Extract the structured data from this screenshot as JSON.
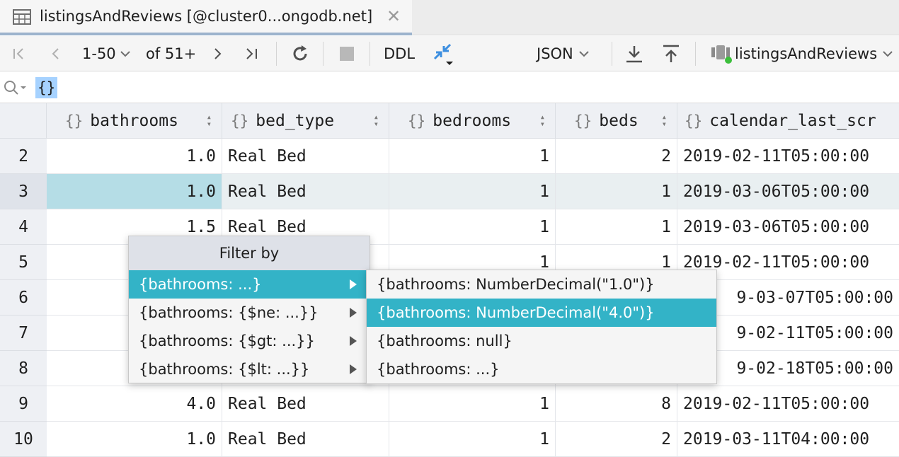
{
  "tab": {
    "title": "listingsAndReviews [@cluster0...ongodb.net]",
    "close_glyph": "✕",
    "icon": "table-icon"
  },
  "toolbar": {
    "page_range": "1-50",
    "page_total": "of 51+",
    "ddl_label": "DDL",
    "view_mode": "JSON",
    "collection": "listingsAndReviews",
    "icons": [
      "first-page-icon",
      "prev-page-icon",
      "chevron-down-icon",
      "next-page-icon",
      "last-page-icon",
      "reload-icon",
      "stop-icon",
      "compare-icon",
      "download-icon",
      "upload-icon",
      "datasource-icon"
    ]
  },
  "filter": {
    "value": "{}"
  },
  "grid": {
    "columns": [
      {
        "icon": "{}",
        "name": "bathrooms"
      },
      {
        "icon": "{}",
        "name": "bed_type"
      },
      {
        "icon": "{}",
        "name": "bedrooms"
      },
      {
        "icon": "{}",
        "name": "beds"
      },
      {
        "icon": "{}",
        "name": "calendar_last_scr"
      }
    ],
    "rows": [
      {
        "n": "2",
        "bathrooms": "1.0",
        "bed_type": "Real Bed",
        "bedrooms": "1",
        "beds": "2",
        "calendar": "2019-02-11T05:00:00"
      },
      {
        "n": "3",
        "bathrooms": "1.0",
        "bed_type": "Real Bed",
        "bedrooms": "1",
        "beds": "1",
        "calendar": "2019-03-06T05:00:00"
      },
      {
        "n": "4",
        "bathrooms": "1.5",
        "bed_type": "Real Bed",
        "bedrooms": "1",
        "beds": "1",
        "calendar": "2019-03-06T05:00:00"
      },
      {
        "n": "5",
        "bathrooms": "",
        "bed_type": "",
        "bedrooms": "1",
        "beds": "1",
        "calendar": "2019-02-11T05:00:00"
      },
      {
        "n": "6",
        "bathrooms": "",
        "bed_type": "",
        "bedrooms": "",
        "beds": "",
        "calendar": "9-03-07T05:00:00"
      },
      {
        "n": "7",
        "bathrooms": "",
        "bed_type": "",
        "bedrooms": "",
        "beds": "",
        "calendar": "9-02-11T05:00:00"
      },
      {
        "n": "8",
        "bathrooms": "",
        "bed_type": "",
        "bedrooms": "",
        "beds": "",
        "calendar": "9-02-18T05:00:00"
      },
      {
        "n": "9",
        "bathrooms": "4.0",
        "bed_type": "Real Bed",
        "bedrooms": "1",
        "beds": "8",
        "calendar": "2019-02-11T05:00:00"
      },
      {
        "n": "10",
        "bathrooms": "1.0",
        "bed_type": "Real Bed",
        "bedrooms": "1",
        "beds": "2",
        "calendar": "2019-03-11T04:00:00"
      }
    ]
  },
  "menu": {
    "title": "Filter by",
    "items": [
      "{bathrooms: ...}",
      "{bathrooms: {$ne: ...}}",
      "{bathrooms: {$gt: ...}}",
      "{bathrooms: {$lt: ...}}"
    ]
  },
  "submenu": {
    "items": [
      "{bathrooms: NumberDecimal(\"1.0\")}",
      "{bathrooms: NumberDecimal(\"4.0\")}",
      "{bathrooms: null}",
      "{bathrooms: ...}"
    ]
  },
  "colors": {
    "highlight": "#33b3c7",
    "selected_cell": "#b5dde6",
    "filter_selection": "#a6d2ff",
    "accent_blue": "#3d8fe0",
    "status_green": "#3cbf3c"
  }
}
